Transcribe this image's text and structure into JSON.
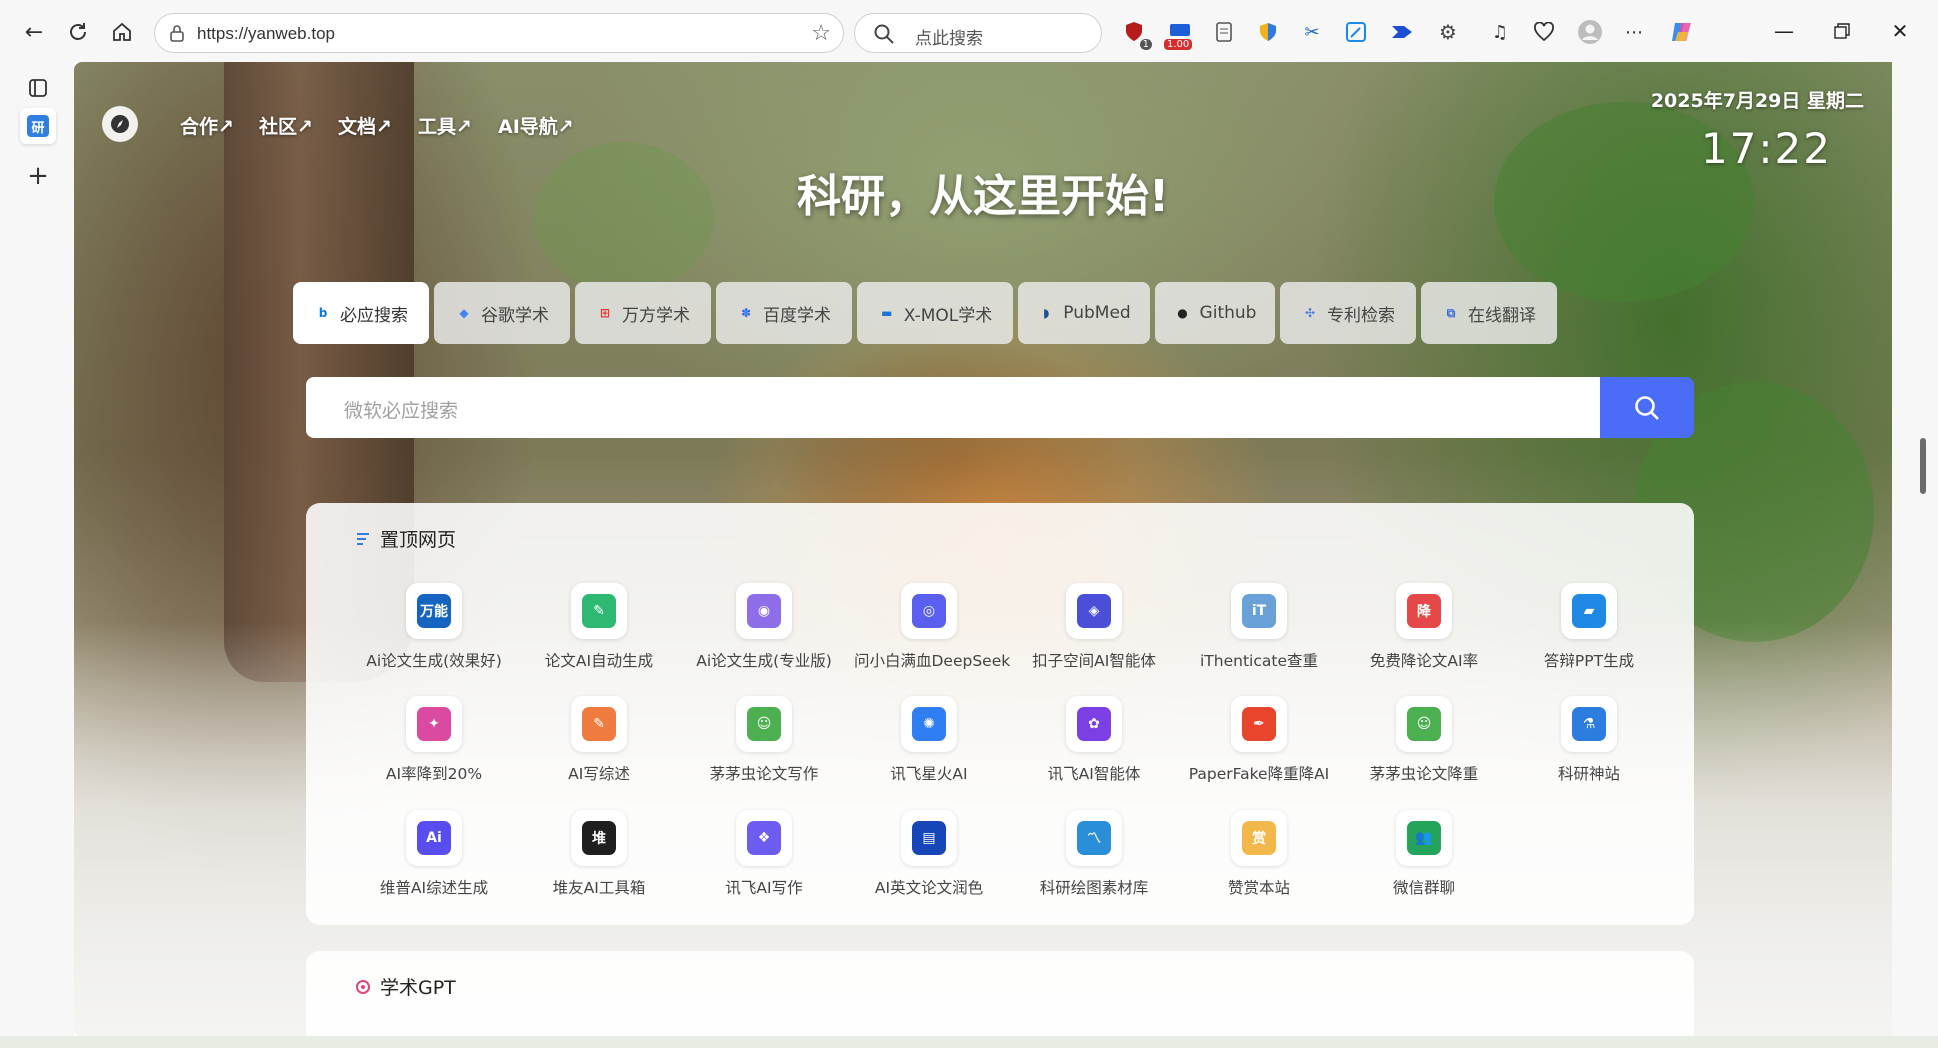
{
  "browser": {
    "url": "https://yanweb.top",
    "search_placeholder": "点此搜索",
    "badge_shield": "1",
    "badge_ext": "1.00"
  },
  "nav": [
    "合作↗",
    "社区↗",
    "文档↗",
    "工具↗",
    "AI导航↗"
  ],
  "date": "2025年7月29日 星期二",
  "clock": "17:22",
  "hero_title": "科研，从这里开始!",
  "engines": [
    {
      "label": "必应搜索",
      "icon": "bing-icon",
      "color": "#0b7bd6",
      "glyph": "b",
      "active": true
    },
    {
      "label": "谷歌学术",
      "icon": "google-scholar-icon",
      "color": "#4285f4",
      "glyph": "◆"
    },
    {
      "label": "万方学术",
      "icon": "wanfang-icon",
      "color": "#e53935",
      "glyph": "⊞"
    },
    {
      "label": "百度学术",
      "icon": "baidu-paw-icon",
      "color": "#2d6be4",
      "glyph": "✽"
    },
    {
      "label": "X-MOL学术",
      "icon": "xmol-icon",
      "color": "#1976d2",
      "glyph": "▬"
    },
    {
      "label": "PubMed",
      "icon": "pubmed-icon",
      "color": "#1f4e99",
      "glyph": "◗"
    },
    {
      "label": "Github",
      "icon": "github-icon",
      "color": "#222222",
      "glyph": "●"
    },
    {
      "label": "专利检索",
      "icon": "patent-icon",
      "color": "#3f7be0",
      "glyph": "✣"
    },
    {
      "label": "在线翻译",
      "icon": "translate-icon",
      "color": "#3a6fd8",
      "glyph": "⧉"
    }
  ],
  "search_placeholder": "微软必应搜索",
  "pinned": {
    "title": "置顶网页",
    "sites": [
      {
        "label": "Ai论文生成(效果好)",
        "icon": "wanneng-paper-icon",
        "color": "#1565c0",
        "glyph": "万能"
      },
      {
        "label": "论文AI自动生成",
        "icon": "leaf-pen-icon",
        "color": "#2eb872",
        "glyph": "✎"
      },
      {
        "label": "Ai论文生成(专业版)",
        "icon": "aibiye-robot-icon",
        "color": "#8e6ee8",
        "glyph": "◉"
      },
      {
        "label": "问小白满血DeepSeek",
        "icon": "wenxiaobai-icon",
        "color": "#5b5ff0",
        "glyph": "◎"
      },
      {
        "label": "扣子空间AI智能体",
        "icon": "coze-icon",
        "color": "#4b4fd8",
        "glyph": "◈"
      },
      {
        "label": "iThenticate查重",
        "icon": "ithenticate-icon",
        "color": "#6aa0d8",
        "glyph": "iT"
      },
      {
        "label": "免费降论文AI率",
        "icon": "jiang-icon",
        "color": "#e54848",
        "glyph": "降"
      },
      {
        "label": "答辩PPT生成",
        "icon": "ppt-chart-icon",
        "color": "#1e88e5",
        "glyph": "▰"
      },
      {
        "label": "AI率降到20%",
        "icon": "ai-rate-icon",
        "color": "#d94aa0",
        "glyph": "✦"
      },
      {
        "label": "AI写综述",
        "icon": "ai-write-icon",
        "color": "#f07b3f",
        "glyph": "✎"
      },
      {
        "label": "茅茅虫论文写作",
        "icon": "maomaochong-icon",
        "color": "#4caf50",
        "glyph": "☺"
      },
      {
        "label": "讯飞星火AI",
        "icon": "xinghuo-icon",
        "color": "#2f7ff2",
        "glyph": "✺"
      },
      {
        "label": "讯飞AI智能体",
        "icon": "xunfei-agent-icon",
        "color": "#7b3fe4",
        "glyph": "✿"
      },
      {
        "label": "PaperFake降重降AI",
        "icon": "paperfake-icon",
        "color": "#e8452c",
        "glyph": "✒"
      },
      {
        "label": "茅茅虫论文降重",
        "icon": "maomaochong-icon",
        "color": "#4caf50",
        "glyph": "☺"
      },
      {
        "label": "科研神站",
        "icon": "science-site-icon",
        "color": "#2d7ddf",
        "glyph": "⚗"
      },
      {
        "label": "维普AI综述生成",
        "icon": "weipu-ai-icon",
        "color": "#5a4df0",
        "glyph": "Ai"
      },
      {
        "label": "堆友AI工具箱",
        "icon": "duiyou-icon",
        "color": "#1f1f1f",
        "glyph": "堆"
      },
      {
        "label": "讯飞AI写作",
        "icon": "xunfei-write-icon",
        "color": "#6c5cf0",
        "glyph": "❖"
      },
      {
        "label": "AI英文论文润色",
        "icon": "doc-polish-icon",
        "color": "#1746b8",
        "glyph": "▤"
      },
      {
        "label": "科研绘图素材库",
        "icon": "drawing-library-icon",
        "color": "#2a8fd8",
        "glyph": "〽"
      },
      {
        "label": "赞赏本站",
        "icon": "reward-icon",
        "color": "#f2b84b",
        "glyph": "赏"
      },
      {
        "label": "微信群聊",
        "icon": "wechat-group-icon",
        "color": "#24a35a",
        "glyph": "👥"
      }
    ]
  },
  "gpt_section": {
    "title": "学术GPT"
  }
}
